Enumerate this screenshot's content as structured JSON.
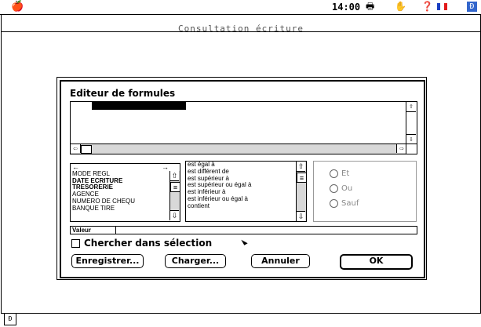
{
  "menubar": {
    "clock": "14:00",
    "apple_icon": "apple-logo-icon",
    "printer_icon": "printer-icon",
    "balloon_icon": "help-hand-icon",
    "help_icon": "question-icon",
    "flag_colors": [
      "#1a3fc2",
      "#ffffff",
      "#e21a1a"
    ],
    "app_icon": "app-menu-icon"
  },
  "window": {
    "title": "Consultation écriture"
  },
  "dialog": {
    "title": "Editeur de formules",
    "fields_header_left": "←",
    "fields_header_right": "→",
    "fields": [
      "MODE REGL",
      "DATE ECRITURE",
      "TRESORERIE",
      "AGENCE",
      "NUMERO DE CHEQU",
      "BANQUE TIRE"
    ],
    "operators": [
      "est égal à",
      "est différent de",
      "est supérieur à",
      "est supérieur ou égal à",
      "est inférieur à",
      "est inférieur ou égal à",
      "contient"
    ],
    "radio": [
      "Et",
      "Ou",
      "Sauf"
    ],
    "value_label": "Valeur",
    "checkbox_label": "Chercher dans sélection",
    "buttons": {
      "save": "Enregistrer...",
      "load": "Charger...",
      "cancel": "Annuler",
      "ok": "OK"
    }
  }
}
